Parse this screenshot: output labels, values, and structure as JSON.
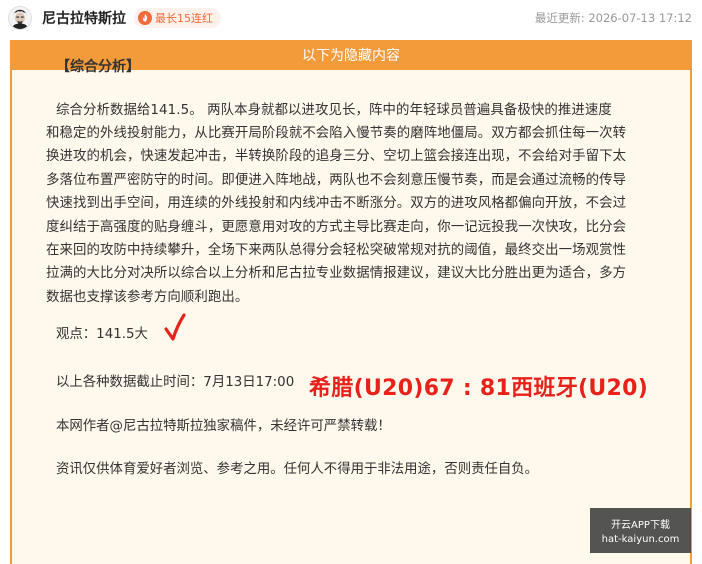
{
  "header": {
    "author": "尼古拉特斯拉",
    "badge": "最长15连红",
    "updated_prefix": "最近更新:",
    "updated_time": "2026-07-13 17:12"
  },
  "frame": {
    "head_title": "以下为隐藏内容"
  },
  "content": {
    "section_title": "【综合分析】",
    "analysis_lines": [
      "综合分析数据给141.5。 两队本身就都以进攻见长，阵中的年轻球员普遍具备极快的推进速度",
      "和稳定的外线投射能力，从比赛开局阶段就不会陷入慢节奏的磨阵地僵局。双方都会抓住每一次转",
      "换进攻的机会，快速发起冲击，半转换阶段的追身三分、空切上篮会接连出现，不会给对手留下太",
      "多落位布置严密防守的时间。即便进入阵地战，两队也不会刻意压慢节奏，而是会通过流畅的传导",
      "快速找到出手空间，用连续的外线投射和内线冲击不断涨分。双方的进攻风格都偏向开放，不会过",
      "度纠结于高强度的贴身缠斗，更愿意用对攻的方式主导比赛走向，你一记远投我一次快攻，比分会",
      "在来回的攻防中持续攀升，全场下来两队总得分会轻松突破常规对抗的阈值，最终交出一场观赏性",
      "拉满的大比分对决所以综合以上分析和尼古拉专业数据情报建议，建议大比分胜出更为适合，多方",
      "数据也支撑该参考方向顺利跑出。"
    ],
    "viewpoint": "观点：141.5大",
    "result": "希腊(U20)67 : 81西班牙(U20)",
    "deadline": "以上各种数据截止时间：7月13日17:00",
    "copyright": "本网作者@尼古拉特斯拉独家稿件，未经许可严禁转载！",
    "disclaimer": "资讯仅供体育爱好者浏览、参考之用。任何人不得用于非法用途，否则责任自负。"
  },
  "app_box": {
    "line1": "开云APP下载",
    "line2": "hat-kaiyun.com"
  },
  "colors": {
    "accent": "#f39a3a",
    "result": "#e8221b",
    "badge_text": "#f26b3a"
  }
}
